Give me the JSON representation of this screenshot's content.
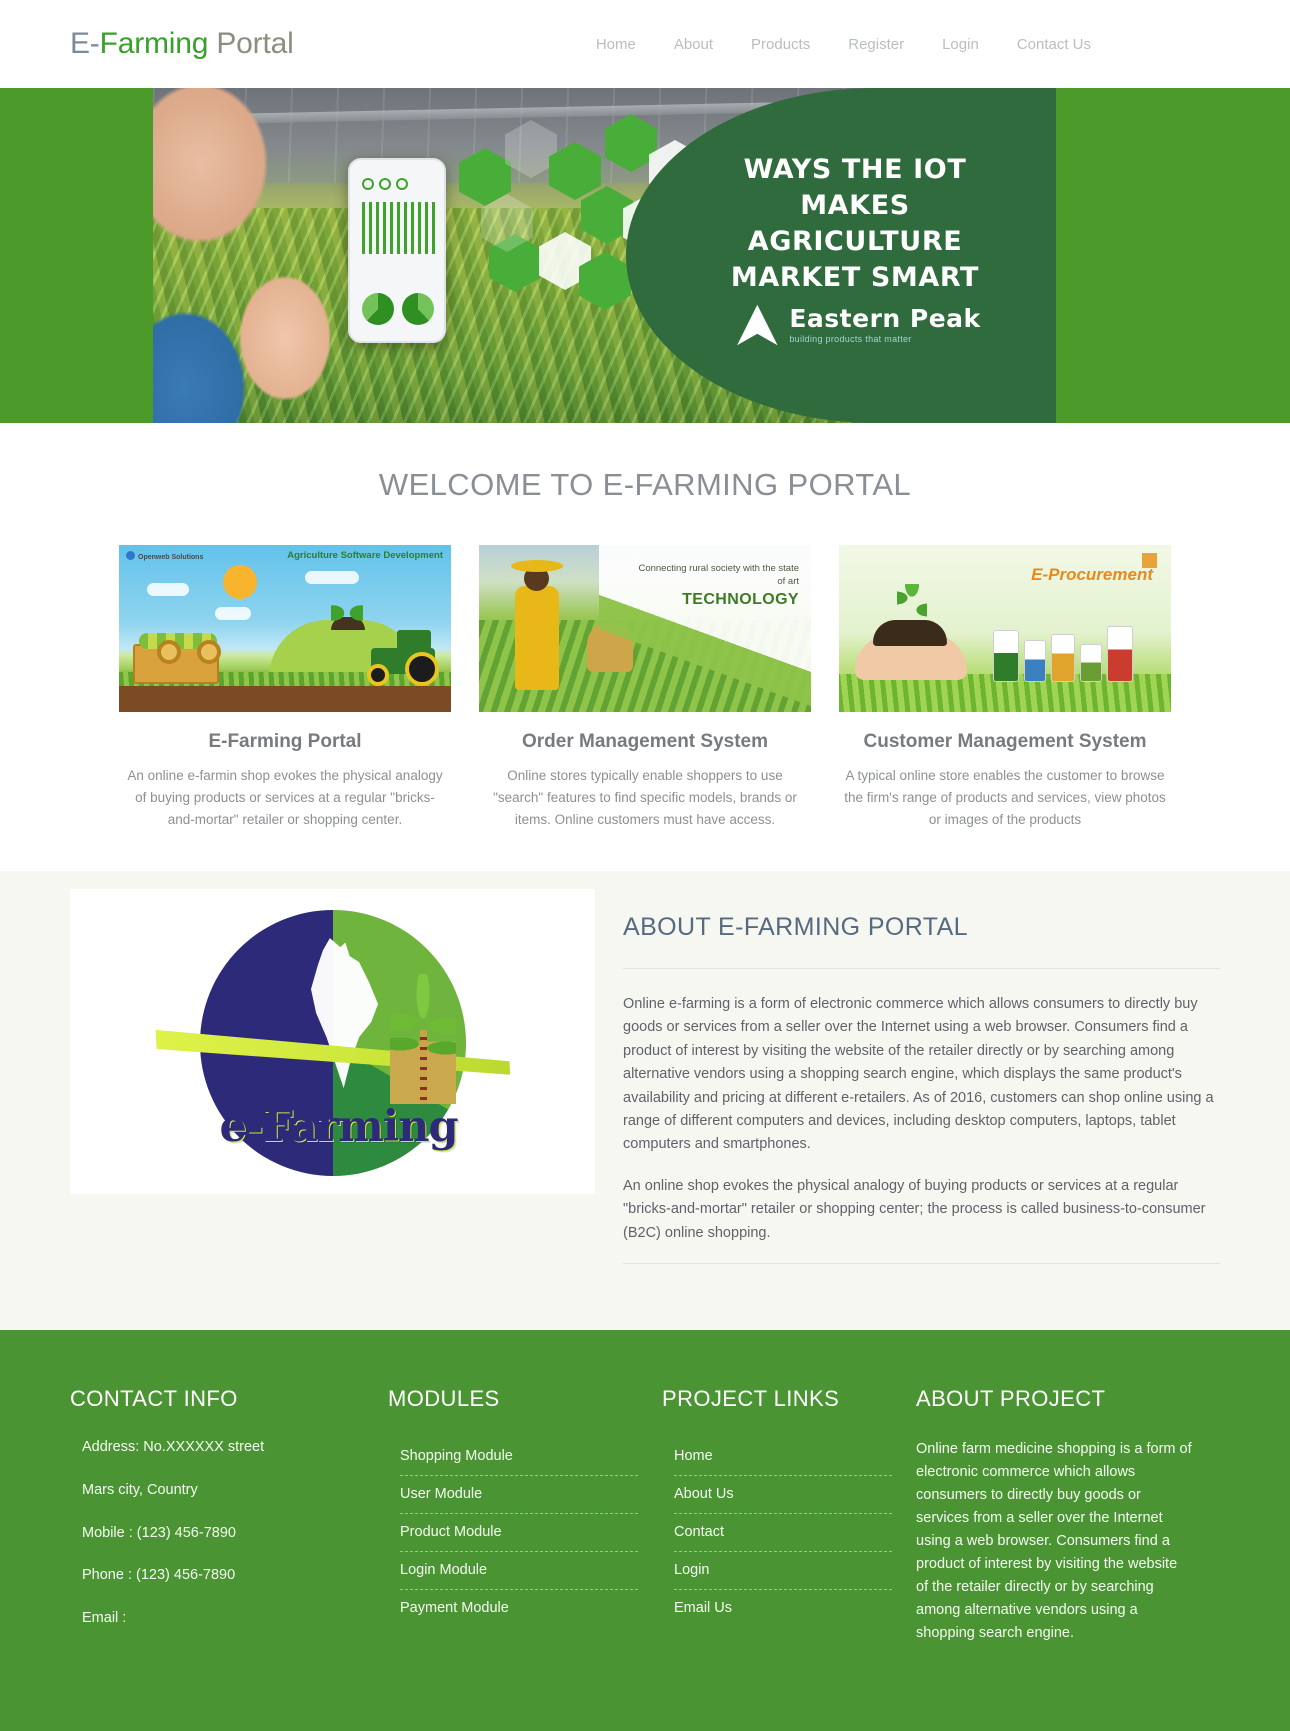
{
  "header": {
    "brand": {
      "part1": "E-",
      "part2": "Farming",
      "part3": " Portal"
    },
    "nav": [
      {
        "label": "Home"
      },
      {
        "label": "About"
      },
      {
        "label": "Products"
      },
      {
        "label": "Register"
      },
      {
        "label": "Login"
      },
      {
        "label": "Contact Us"
      }
    ]
  },
  "hero": {
    "headline": "WAYS THE IOT MAKES AGRICULTURE MARKET SMART",
    "logo_name": "Eastern Peak",
    "logo_tagline": "building products that matter"
  },
  "welcome": {
    "title": "WELCOME TO E-FARMING PORTAL",
    "cards": [
      {
        "title": "E-Farming Portal",
        "text": "An online e-farmin shop evokes the physical analogy of buying products or services at a regular \"bricks-and-mortar\" retailer or shopping center.",
        "image_label_brand": "Openweb Solutions",
        "image_label_title": "Agriculture Software Development"
      },
      {
        "title": "Order Management System",
        "text": "Online stores typically enable shoppers to use \"search\" features to find specific models, brands or items. Online customers must have access.",
        "image_label_top": "Connecting  rural society with the state of art",
        "image_label_big": "TECHNOLOGY"
      },
      {
        "title": "Customer Management System",
        "text": "A typical online store enables the customer to browse the firm's range of products and services, view photos or images of the products",
        "image_label_big": "E-Procurement"
      }
    ]
  },
  "about": {
    "logo_wordmark": "e-Farming",
    "title": "ABOUT E-FARMING PORTAL",
    "paragraphs": [
      "Online e-farming is a form of electronic commerce which allows consumers to directly buy goods or services from a seller over the Internet using a web browser. Consumers find a product of interest by visiting the website of the retailer directly or by searching among alternative vendors using a shopping search engine, which displays the same product's availability and pricing at different e-retailers. As of 2016, customers can shop online using a range of different computers and devices, including desktop computers, laptops, tablet computers and smartphones.",
      "An online shop evokes the physical analogy of buying products or services at a regular \"bricks-and-mortar\" retailer or shopping center; the process is called business-to-consumer (B2C) online shopping."
    ]
  },
  "footer": {
    "contact": {
      "title": "CONTACT INFO",
      "items": [
        "Address: No.XXXXXX street",
        "Mars city, Country",
        "Mobile : (123) 456-7890",
        "Phone : (123) 456-7890",
        "Email :"
      ]
    },
    "modules": {
      "title": "MODULES",
      "items": [
        {
          "label": "Shopping Module"
        },
        {
          "label": "User Module"
        },
        {
          "label": "Product Module"
        },
        {
          "label": "Login Module"
        },
        {
          "label": "Payment Module"
        }
      ]
    },
    "project_links": {
      "title": "PROJECT LINKS",
      "items": [
        {
          "label": "Home"
        },
        {
          "label": "About Us"
        },
        {
          "label": "Contact"
        },
        {
          "label": "Login"
        },
        {
          "label": "Email Us"
        }
      ]
    },
    "about_project": {
      "title": "ABOUT PROJECT",
      "text": "Online farm medicine shopping is a form of electronic commerce which allows consumers to directly buy goods or services from a seller over the Internet using a web browser. Consumers find a product of interest by visiting the website of the retailer directly or by searching among alternative vendors using a shopping search engine."
    }
  },
  "colors": {
    "brand_green": "#3aa02c",
    "footer_green": "#4a9433",
    "hero_green": "#4c9a2a",
    "about_bg": "#f7f7f2",
    "nav_text": "#b9bdc3"
  }
}
